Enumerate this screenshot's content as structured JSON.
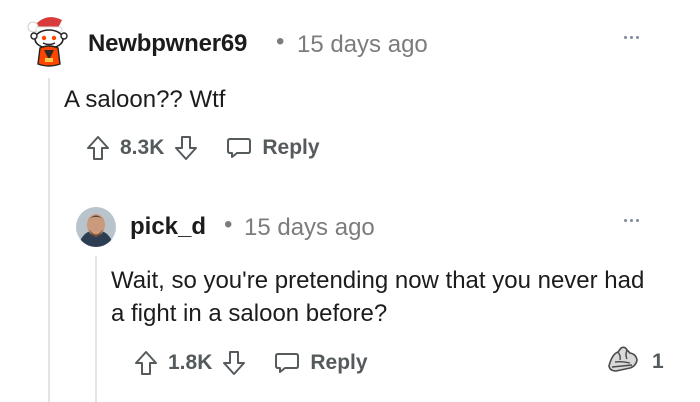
{
  "comments": [
    {
      "author": "Newbpwner69",
      "separator": "•",
      "time": "15 days ago",
      "body": "A saloon?? Wtf",
      "score": "8.3K",
      "reply_label": "Reply",
      "avatar_icon": "snoo-santa-hat-avatar-icon"
    },
    {
      "author": "pick_d",
      "separator": "•",
      "time": "15 days ago",
      "body": "Wait, so you're pretending now that you never had a fight in a saloon before?",
      "score": "1.8K",
      "reply_label": "Reply",
      "avatar_icon": "user-photo-avatar",
      "award_icon": "arm-wrestle-award-icon",
      "award_count": "1"
    }
  ],
  "colors": {
    "text": "#1c1c1c",
    "meta": "#7c7c7c",
    "action": "#555a5d",
    "thread_line": "#e2e4e6",
    "snoo_red": "#ff4500"
  }
}
